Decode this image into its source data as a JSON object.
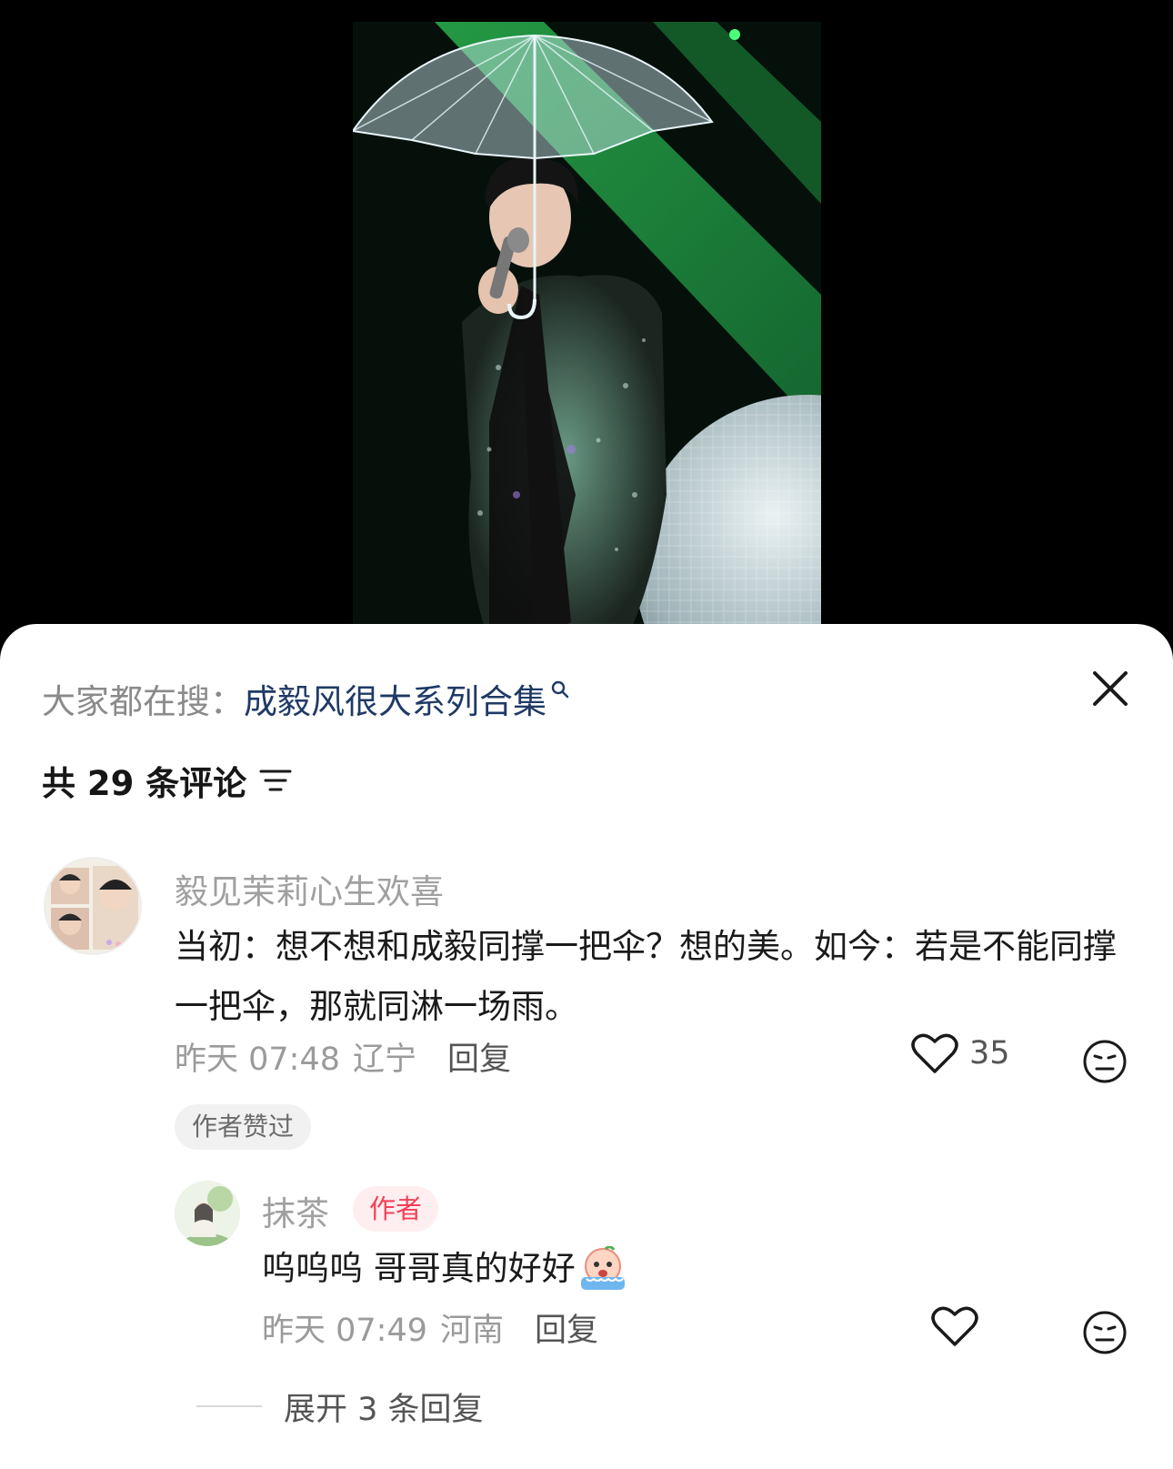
{
  "video": {
    "description_icon": "video-frame"
  },
  "sheet": {
    "search_prefix": "大家都在搜：",
    "search_term": "成毅风很大系列合集",
    "comment_count_label": "共 29 条评论",
    "icons": {
      "close": "close-icon",
      "sort": "sort-icon",
      "search": "search-icon"
    }
  },
  "comments": [
    {
      "username": "毅见茉莉心生欢喜",
      "content": "当初：想不想和成毅同撑一把伞？想的美。如今：若是不能同撑一把伞，那就同淋一场雨。",
      "time": "昨天 07:48",
      "location": "辽宁",
      "reply_label": "回复",
      "likes": "35",
      "liked_by_author": "作者赞过"
    }
  ],
  "replies": [
    {
      "username": "抹茶",
      "badge": "作者",
      "content": "呜呜呜 哥哥真的好好",
      "emoji": "crying-face-emoji",
      "time": "昨天 07:49",
      "location": "河南",
      "reply_label": "回复"
    }
  ],
  "expand_label": "展开 3 条回复",
  "colors": {
    "accent_link": "#1f3a66",
    "author_badge_text": "#f24058",
    "author_badge_bg": "#ffeef0"
  }
}
